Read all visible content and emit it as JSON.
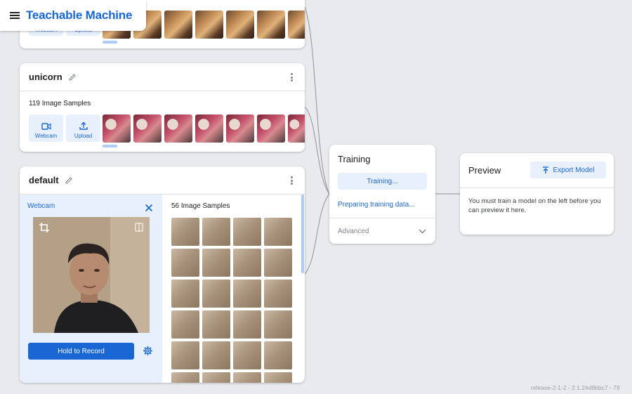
{
  "app": {
    "title": "Teachable Machine"
  },
  "classes": [
    {
      "name": "",
      "sources": {
        "webcam": "Webcam",
        "upload": "Upload"
      },
      "thumb_type": "guitar",
      "thumb_count": 7
    },
    {
      "name": "unicorn",
      "samples_label": "119 Image Samples",
      "sources": {
        "webcam": "Webcam",
        "upload": "Upload"
      },
      "thumb_type": "unicorn",
      "thumb_count": 7
    },
    {
      "name": "default",
      "webcam_label": "Webcam",
      "record_label": "Hold to Record",
      "samples_label": "56 Image Samples",
      "grid_rows": 6
    }
  ],
  "training": {
    "title": "Training",
    "button_label": "Training...",
    "status": "Preparing training data...",
    "advanced_label": "Advanced"
  },
  "preview": {
    "title": "Preview",
    "export_label": "Export Model",
    "message": "You must train a model on the left before you can preview it here."
  },
  "footer": {
    "version": "release-2-1-2 - 2.1.2#d9bbc7 - 79"
  },
  "colors": {
    "accent": "#1967d2",
    "accent_light": "#e8f0fe",
    "background": "#e8eaed"
  }
}
